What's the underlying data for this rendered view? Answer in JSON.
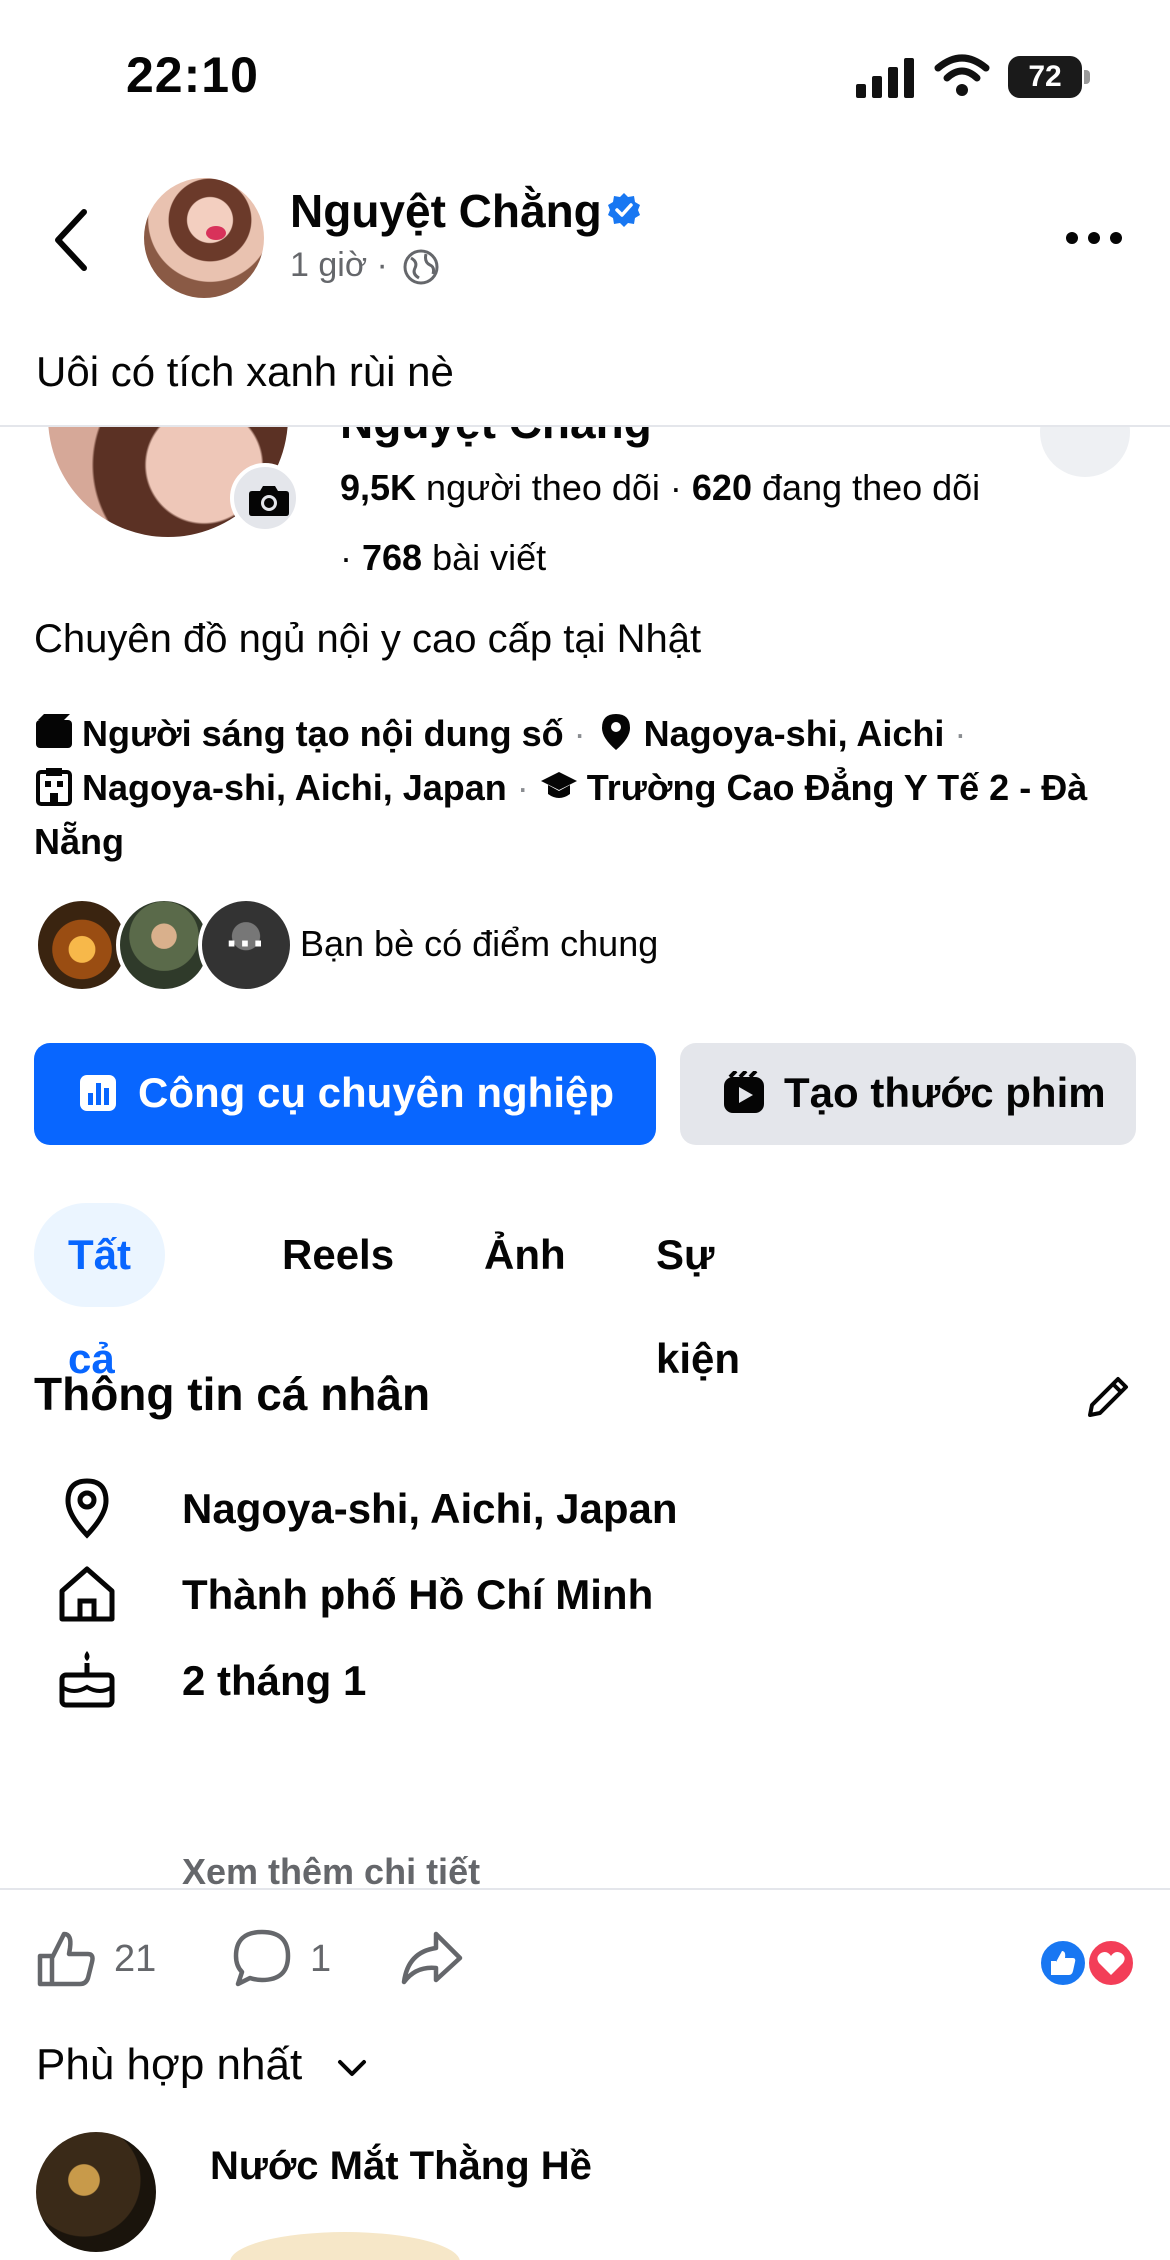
{
  "status_bar": {
    "time": "22:10",
    "battery": "72"
  },
  "post": {
    "author": "Nguyệt Chằng",
    "meta": "1 giờ ·",
    "caption": "Uôi có tích xanh rùi nè",
    "reactions": {
      "likes": "21",
      "comments": "1"
    }
  },
  "profile_screenshot": {
    "cut_title": "Nguyệt Chằng",
    "stats_line1": {
      "followers": "9,5K",
      "followers_label": " người theo dõi · ",
      "following": "620",
      "following_label": " đang theo dõi"
    },
    "stats_line2": {
      "prefix": "· ",
      "posts": "768",
      "posts_label": " bài viết"
    },
    "bio": "Chuyên đồ ngủ nội y cao cấp tại Nhật",
    "details": {
      "creator": "Người sáng tạo nội dung số",
      "location": "Nagoya-shi, Aichi",
      "city": "Nagoya-shi, Aichi, Japan",
      "school": "Trường Cao Đẳng Y Tế 2 - Đà Nẵng",
      "sep": "·"
    },
    "mutual_more": "···",
    "mutual_label": "Bạn bè có điểm chung",
    "buttons": {
      "pro": "Công cụ chuyên nghiệp",
      "reel": "Tạo thước phim"
    },
    "tabs": [
      "Tất cả",
      "Reels",
      "Ảnh",
      "Sự kiện"
    ],
    "section_title": "Thông tin cá nhân",
    "info": [
      {
        "icon": "location-pin-icon",
        "text": "Nagoya-shi, Aichi, Japan"
      },
      {
        "icon": "home-icon",
        "text": "Thành phố Hồ Chí Minh"
      },
      {
        "icon": "birthday-cake-icon",
        "text": "2 tháng 1"
      }
    ],
    "see_more": "Xem thêm chi tiết"
  },
  "comments": {
    "sort_label": "Phù hợp nhất",
    "first_commenter": "Nước Mắt Thằng Hề"
  },
  "colors": {
    "primary": "#0866ff",
    "verified": "#1877f2",
    "love": "#f33e58",
    "secondary_text": "#65676b"
  }
}
